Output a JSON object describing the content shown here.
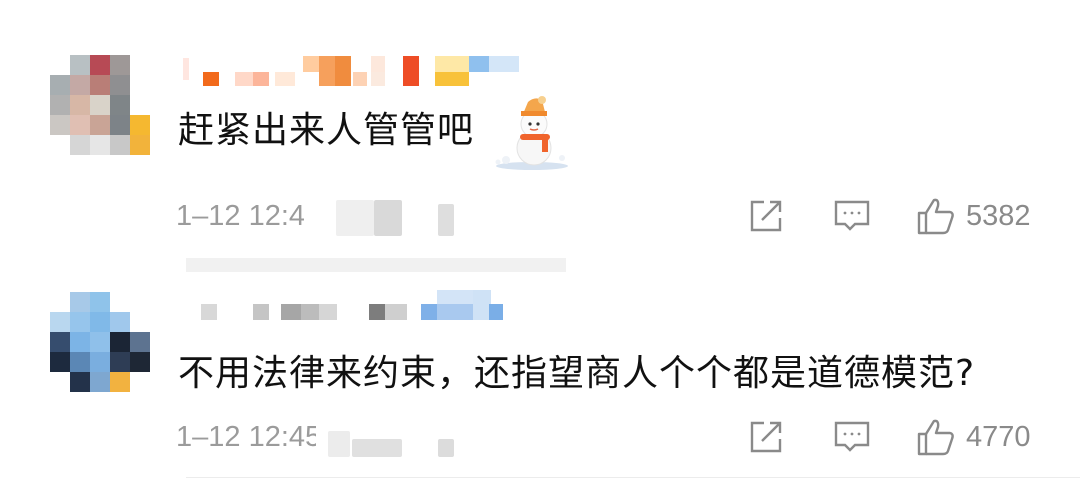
{
  "comments": [
    {
      "text": "赶紧出来人管管吧",
      "time": "1–12 12:4",
      "likes": "5382",
      "sticker": "snowman-sticker",
      "avatar_colors": [
        [
          "#ffffff",
          "#b8c0c3",
          "#b74a55",
          "#9e9897",
          "#ffffff"
        ],
        [
          "#a7aeb1",
          "#c4a9a5",
          "#b97e77",
          "#8f8f91",
          "#ffffff"
        ],
        [
          "#b1b1b1",
          "#d7b7a6",
          "#d9d3c9",
          "#7f8588",
          "#ffffff"
        ],
        [
          "#cbc7c3",
          "#e0bfb3",
          "#c9a496",
          "#7d8388",
          "#f5b830"
        ],
        [
          "#ffffff",
          "#d6d6d6",
          "#e6e6e6",
          "#c8c8c8",
          "#f2b33b"
        ]
      ]
    },
    {
      "text": "不用法律来约束，还指望商人个个都是道德模范?",
      "time": "1–12 12:45",
      "likes": "4770",
      "avatar_colors": [
        [
          "#ffffff",
          "#a7c9e8",
          "#8fc3ea",
          "#ffffff",
          "#ffffff"
        ],
        [
          "#b9d7ef",
          "#96c5ec",
          "#80b9e8",
          "#a0c8ec",
          "#ffffff"
        ],
        [
          "#364d6e",
          "#7cb4e6",
          "#8fc0ea",
          "#1b2535",
          "#5d7390"
        ],
        [
          "#1d2a3e",
          "#5b87b5",
          "#7aaedf",
          "#2e3d55",
          "#1e2735"
        ],
        [
          "#ffffff",
          "#23324a",
          "#7ea7d0",
          "#f2b240",
          "#ffffff"
        ]
      ]
    }
  ],
  "colors": {
    "text": "#111111",
    "meta": "#9b9b9b",
    "icon": "#8a8a8a"
  }
}
